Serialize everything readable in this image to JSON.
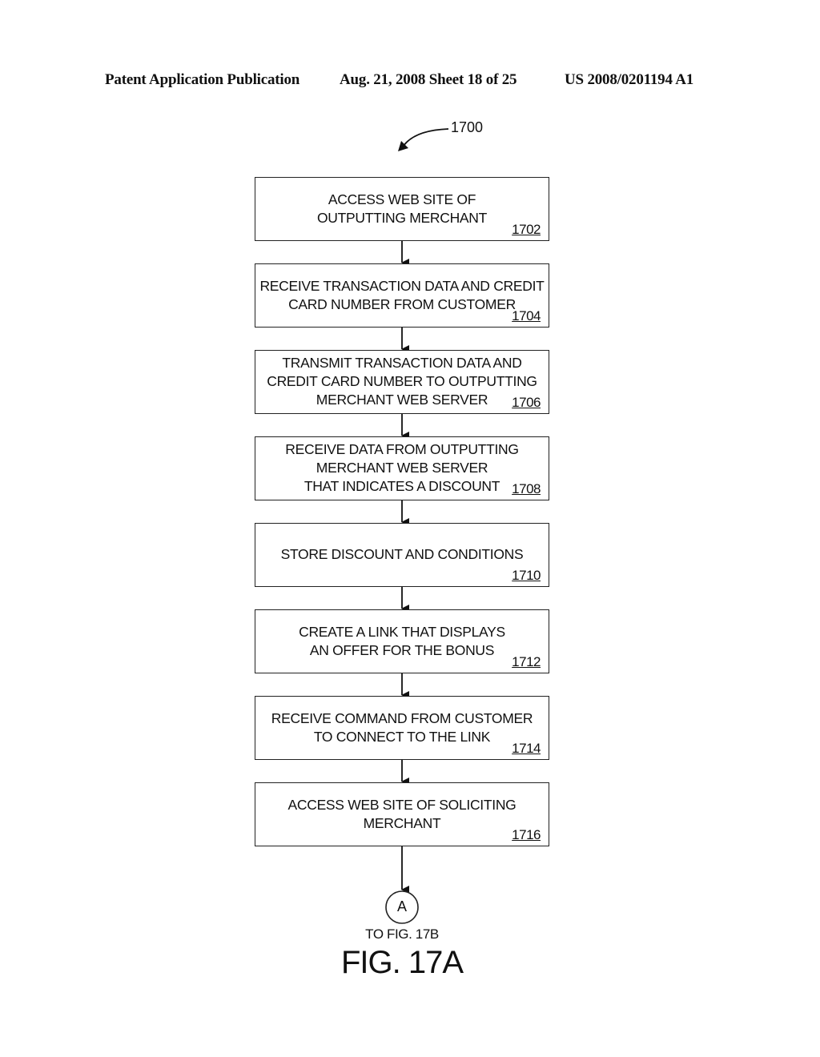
{
  "header": {
    "publication": "Patent Application Publication",
    "date_sheet": "Aug. 21, 2008  Sheet 18 of 25",
    "number": "US 2008/0201194 A1"
  },
  "figure_ref": "1700",
  "steps": [
    {
      "text": "ACCESS WEB SITE OF\nOUTPUTTING MERCHANT",
      "number": "1702"
    },
    {
      "text": "RECEIVE TRANSACTION DATA AND CREDIT\nCARD NUMBER FROM CUSTOMER",
      "number": "1704"
    },
    {
      "text": "TRANSMIT TRANSACTION DATA AND\nCREDIT CARD NUMBER TO OUTPUTTING\nMERCHANT WEB SERVER",
      "number": "1706"
    },
    {
      "text": "RECEIVE DATA FROM OUTPUTTING\nMERCHANT WEB SERVER\nTHAT INDICATES A DISCOUNT",
      "number": "1708"
    },
    {
      "text": "STORE DISCOUNT AND CONDITIONS",
      "number": "1710"
    },
    {
      "text": "CREATE A LINK THAT DISPLAYS\nAN OFFER FOR THE BONUS",
      "number": "1712"
    },
    {
      "text": "RECEIVE COMMAND FROM CUSTOMER\nTO CONNECT TO THE LINK",
      "number": "1714"
    },
    {
      "text": "ACCESS WEB SITE OF SOLICITING\nMERCHANT",
      "number": "1716"
    }
  ],
  "connector": {
    "letter": "A",
    "caption": "TO FIG. 17B"
  },
  "figure_label": "FIG. 17A"
}
